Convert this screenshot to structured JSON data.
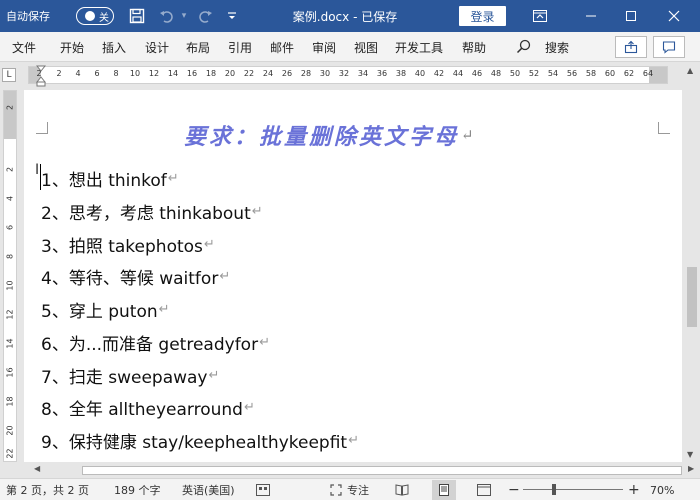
{
  "titlebar": {
    "autosave_label": "自动保存",
    "autosave_state": "关",
    "doc_title": "案例.docx - 已保存",
    "login_label": "登录"
  },
  "menu": {
    "tabs": [
      "文件",
      "开始",
      "插入",
      "设计",
      "布局",
      "引用",
      "邮件",
      "审阅",
      "视图",
      "开发工具",
      "帮助"
    ],
    "search_label": "搜索"
  },
  "ruler": {
    "marks": [
      "2",
      "2",
      "4",
      "6",
      "8",
      "10",
      "12",
      "14",
      "16",
      "18",
      "20",
      "22",
      "24",
      "26",
      "28",
      "30",
      "32",
      "34",
      "36",
      "38",
      "40",
      "42",
      "44",
      "46",
      "48",
      "50",
      "52",
      "54",
      "56",
      "58",
      "60",
      "62",
      "64"
    ],
    "corner_label": "L"
  },
  "vruler": {
    "marks": [
      "2",
      "2",
      "4",
      "6",
      "8",
      "10",
      "12",
      "14",
      "16",
      "18",
      "20",
      "22"
    ]
  },
  "document": {
    "heading": "要求：批量删除英文字母",
    "lines": [
      "1、想出 thinkof",
      "2、思考，考虑 thinkabout",
      "3、拍照 takephotos",
      "4、等待、等候 waitfor",
      "5、穿上 puton",
      "6、为...而准备 getreadyfor",
      "7、扫走 sweepaway",
      "8、全年 alltheyearround",
      "9、保持健康 stay/keephealthykeepfit"
    ]
  },
  "statusbar": {
    "page": "第 2 页，共 2 页",
    "words": "189 个字",
    "language": "英语(美国)",
    "focus": "专注",
    "zoom": "70%"
  },
  "colors": {
    "titlebar": "#2b579a",
    "heading": "#6a72d8"
  }
}
